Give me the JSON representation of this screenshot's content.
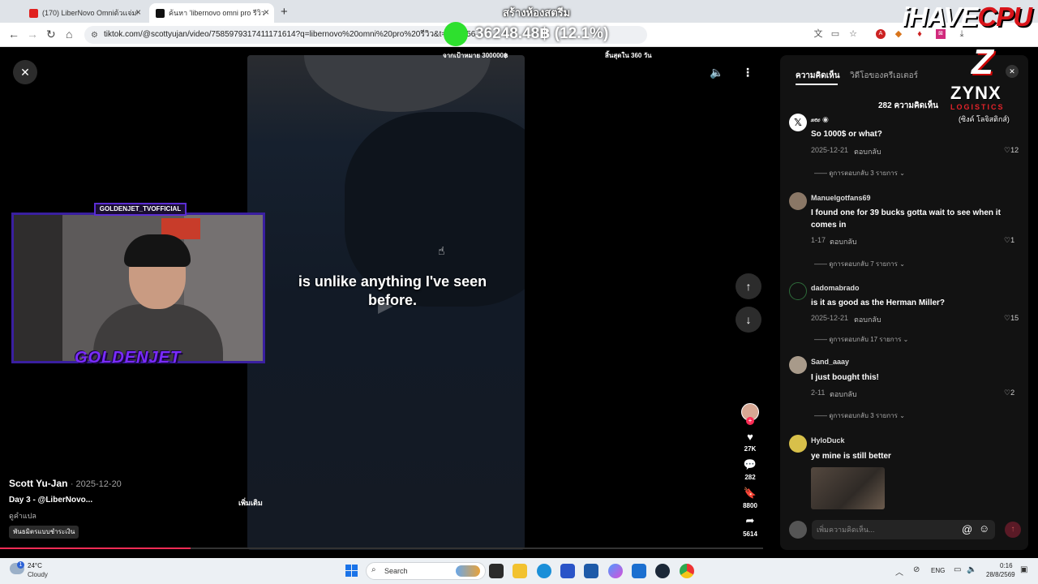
{
  "browser": {
    "tabs": [
      {
        "title": "(170) LiberNovo Omniต้วแจ่มพิมพ์",
        "favicon_color": "#e0201e"
      },
      {
        "title": "ค้นหา 'libernovo omni pro รีวิว' u",
        "favicon_color": "#111111"
      }
    ],
    "new_tab": "+",
    "url": "tiktok.com/@scottyujan/video/7585979317411171614?q=libernovo%20omni%20pro%20รีวิว&t=1787",
    "url_tail": "56"
  },
  "stream_overlay": {
    "title": "สร้างห้องสตรีม",
    "goal_amount": "36248.48฿ (12.1%)",
    "goal_target": "จากเป้าหมาย 300000฿",
    "goal_ends": "สิ้นสุดใน 360 วัน",
    "brand_ihave": "iHAVE",
    "brand_cpu": "CPU",
    "sponsor_mark": "Z",
    "sponsor_name": "ZYNX",
    "sponsor_sub": "LOGISTICS",
    "sponsor_thai": "(ซิงค์ โลจิสติกส์)",
    "webcam_tag": "GOLDENJET_TVOFFICIAL",
    "webcam_name": "GOLDENJET"
  },
  "video": {
    "caption": "is unlike anything I've seen before.",
    "author": "Scott Yu-Jan",
    "date": "· 2025-12-20",
    "description": "Day 3 - @LiberNovo...",
    "more_label": "เพิ่มเติม",
    "translate_label": "ดูคำแปล",
    "tag_chip": "พันธมิตรแบบชำระเงิน",
    "progress": 0.25
  },
  "actions": {
    "likes": "27K",
    "comments": "282",
    "saves": "8800",
    "shares": "5614"
  },
  "comments_panel": {
    "tab_comments": "ความคิดเห็น",
    "tab_creator": "วิดีโอของครีเอเตอร์",
    "count": "282 ความคิดเห็น",
    "reply_label": "ตอบกลับ",
    "composer_placeholder": "เพิ่มความคิดเห็น...",
    "items": [
      {
        "user": "𝓍𝑒𝒸 ◉",
        "text": "So 1000$ or what?",
        "date": "2025-12-21",
        "likes": "12",
        "thread": "ดูการตอบกลับ 3 รายการ",
        "avatar_color": "#ffffff"
      },
      {
        "user": "Manuelgotfans69",
        "text": "I found one for 39 bucks gotta wait to see when it comes in",
        "date": "1-17",
        "likes": "1",
        "thread": "ดูการตอบกลับ 7 รายการ",
        "avatar_color": "#8a7766"
      },
      {
        "user": "dadomabrado",
        "text": "is it as good as the Herman Miller?",
        "date": "2025-12-21",
        "likes": "15",
        "thread": "ดูการตอบกลับ 17 รายการ",
        "avatar_color": "#2e6b3a"
      },
      {
        "user": "Sand_aaay",
        "text": "I just bought this!",
        "date": "2-11",
        "likes": "2",
        "thread": "ดูการตอบกลับ 3 รายการ",
        "avatar_color": "#a89a8a"
      },
      {
        "user": "HyloDuck",
        "text": "ye mine is still better",
        "avatar_color": "#d8c04a"
      }
    ]
  },
  "taskbar": {
    "temp": "24°C",
    "condition": "Cloudy",
    "weather_badge": "1",
    "search_label": "Search",
    "lang": "ENG",
    "time": "0:16",
    "date": "28/8/2569"
  }
}
